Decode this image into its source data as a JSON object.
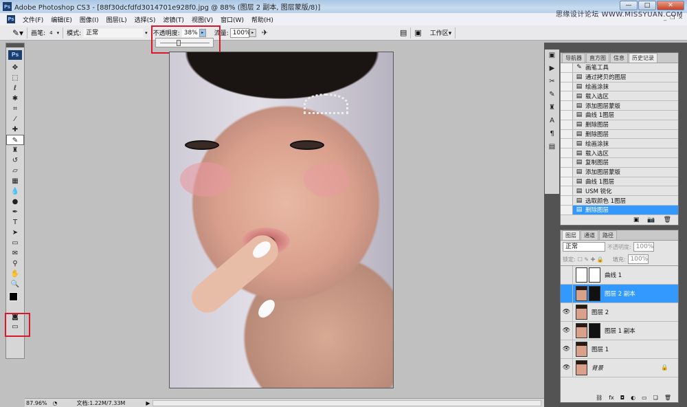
{
  "titlebar": {
    "app_icon": "Ps",
    "title": "Adobe Photoshop CS3 - [88f30dcfdfd3014701e928f0.jpg @ 88% (图层 2 副本, 图层蒙版/8)]",
    "minimize": "—",
    "maximize": "□",
    "close": "✕"
  },
  "watermark": "思缘设计论坛 WWW.MISSYUAN.COM",
  "menubar": {
    "items": [
      "文件(F)",
      "编辑(E)",
      "图像(I)",
      "图层(L)",
      "选择(S)",
      "滤镜(T)",
      "视图(V)",
      "窗口(W)",
      "帮助(H)"
    ]
  },
  "options": {
    "brush_label": "画笔:",
    "brush_size": "4",
    "mode_label": "模式:",
    "mode_value": "正常",
    "opacity_label": "不透明度:",
    "opacity_value": "38%",
    "opacity_fraction": 0.38,
    "flow_label": "流量:",
    "flow_value": "100%",
    "workspace_label": "工作区▾"
  },
  "history_panel": {
    "tabs": [
      "导航器",
      "直方图",
      "信息",
      "历史记录"
    ],
    "active_tab": 3,
    "items": [
      "画笔工具",
      "通过拷贝的图层",
      "绘画涂抹",
      "载入选区",
      "添加图层蒙版",
      "曲线 1图层",
      "删除图层",
      "删除图层",
      "绘画涂抹",
      "载入选区",
      "复制图层",
      "添加图层蒙版",
      "曲线 1图层",
      "USM 锐化",
      "选取颜色 1图层",
      "删除图层"
    ],
    "selected_index": 15
  },
  "layers_panel": {
    "tabs": [
      "图层",
      "通道",
      "路径"
    ],
    "blend_mode": "正常",
    "opacity_label": "不透明度:",
    "opacity_value": "100%",
    "lock_label": "锁定:",
    "fill_label": "填充:",
    "fill_value": "100%",
    "layers": [
      {
        "name": "曲线 1",
        "visible": false,
        "type": "adjustment"
      },
      {
        "name": "图层 2 副本",
        "visible": false,
        "mask": true,
        "selected": true
      },
      {
        "name": "图层 2",
        "visible": true
      },
      {
        "name": "图层 1 副本",
        "visible": true,
        "mask": true
      },
      {
        "name": "图层 1",
        "visible": true
      },
      {
        "name": "背景",
        "visible": true,
        "locked": true
      }
    ]
  },
  "statusbar": {
    "zoom": "87.96%",
    "doc": "文档:1.22M/7.33M"
  },
  "colors": {
    "accent": "#3399ff",
    "highlight": "#d8182a"
  }
}
